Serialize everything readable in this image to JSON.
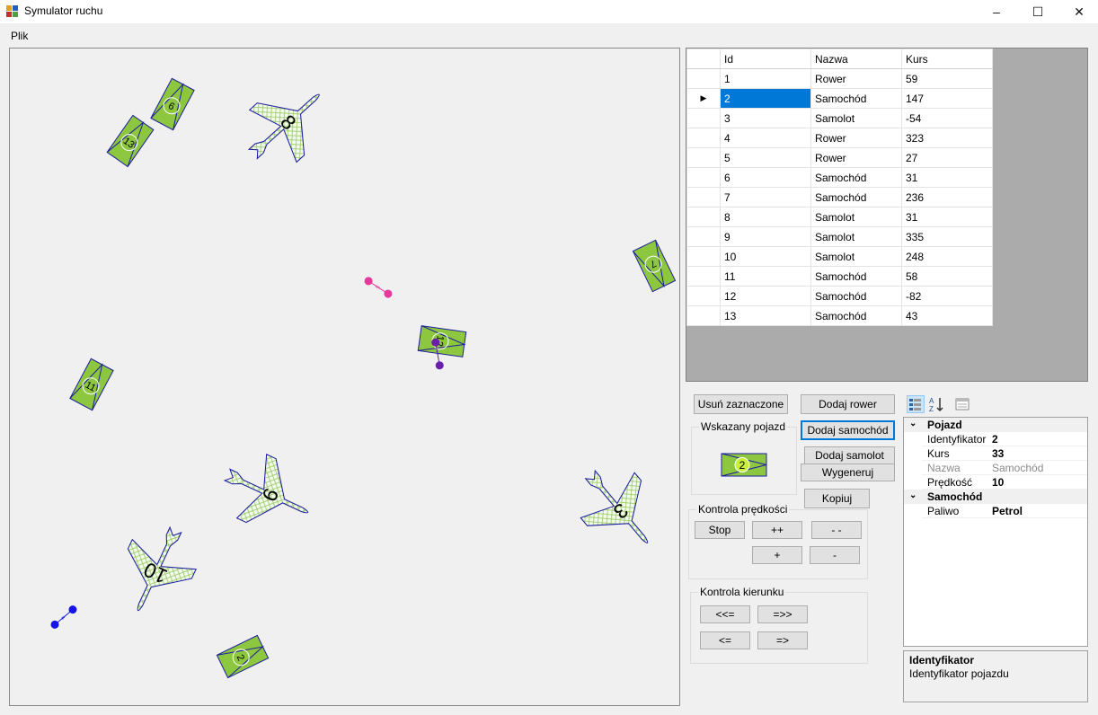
{
  "window": {
    "title": "Symulator ruchu",
    "controls": [
      "–",
      "☐",
      "✕"
    ]
  },
  "menu": [
    "Plik"
  ],
  "grid": {
    "columns": [
      "Id",
      "Nazwa",
      "Kurs"
    ],
    "selected_id": "2",
    "row_indicator": "▶",
    "rows": [
      {
        "id": "1",
        "name": "Rower",
        "kurs": "59"
      },
      {
        "id": "2",
        "name": "Samochód",
        "kurs": "147"
      },
      {
        "id": "3",
        "name": "Samolot",
        "kurs": "-54"
      },
      {
        "id": "4",
        "name": "Rower",
        "kurs": "323"
      },
      {
        "id": "5",
        "name": "Rower",
        "kurs": "27"
      },
      {
        "id": "6",
        "name": "Samochód",
        "kurs": "31"
      },
      {
        "id": "7",
        "name": "Samochód",
        "kurs": "236"
      },
      {
        "id": "8",
        "name": "Samolot",
        "kurs": "31"
      },
      {
        "id": "9",
        "name": "Samolot",
        "kurs": "335"
      },
      {
        "id": "10",
        "name": "Samolot",
        "kurs": "248"
      },
      {
        "id": "11",
        "name": "Samochód",
        "kurs": "58"
      },
      {
        "id": "12",
        "name": "Samochód",
        "kurs": "-82"
      },
      {
        "id": "13",
        "name": "Samochód",
        "kurs": "43"
      }
    ]
  },
  "buttons": {
    "delete_selected": "Usuń zaznaczone",
    "add_bike": "Dodaj rower",
    "add_car": "Dodaj samochód",
    "add_plane": "Dodaj samolot",
    "generate": "Wygeneruj",
    "copy": "Kopiuj"
  },
  "indicated": {
    "label": "Wskazany pojazd",
    "vehicle_number": "2"
  },
  "speed": {
    "label": "Kontrola prędkości",
    "stop": "Stop",
    "fast_up": "++",
    "fast_down": "- -",
    "up": "+",
    "down": "-"
  },
  "direction": {
    "label": "Kontrola kierunku",
    "fast_left": "<<=",
    "fast_right": "=>>",
    "left": "<=",
    "right": "=>"
  },
  "properties": {
    "categories": [
      {
        "name": "Pojazd",
        "props": [
          {
            "name": "Identyfikator",
            "value": "2",
            "readonly": false
          },
          {
            "name": "Kurs",
            "value": "33",
            "readonly": false
          },
          {
            "name": "Nazwa",
            "value": "Samochód",
            "readonly": true
          },
          {
            "name": "Prędkość",
            "value": "10",
            "readonly": false
          }
        ]
      },
      {
        "name": "Samochód",
        "props": [
          {
            "name": "Paliwo",
            "value": "Petrol",
            "readonly": false
          }
        ]
      }
    ],
    "description_title": "Identyfikator",
    "description_text": "Identyfikator pojazdu"
  },
  "vehicles": {
    "cars": [
      {
        "num": "6",
        "kurs": 31
      },
      {
        "num": "13",
        "kurs": 43
      },
      {
        "num": "7",
        "kurs": 236
      },
      {
        "num": "12",
        "kurs": -82
      },
      {
        "num": "11",
        "kurs": 58
      },
      {
        "num": "2",
        "kurs": 147
      }
    ],
    "planes": [
      {
        "num": "8",
        "kurs": 31
      },
      {
        "num": "9",
        "kurs": 335
      },
      {
        "num": "3",
        "kurs": -54
      },
      {
        "num": "10",
        "kurs": 248
      }
    ],
    "bikes": [
      {
        "num": "5",
        "color": "#e6399b"
      },
      {
        "num": "1",
        "color": "#6a1fa8"
      },
      {
        "num": "4",
        "color": "#1414e6"
      }
    ]
  },
  "colors": {
    "car_fill": "#8dc63f",
    "car_border": "#1a1aa0",
    "plane_fill": "#d8f0c0",
    "selected": "#0078d7",
    "circle_highlight": "#c8f03c"
  }
}
